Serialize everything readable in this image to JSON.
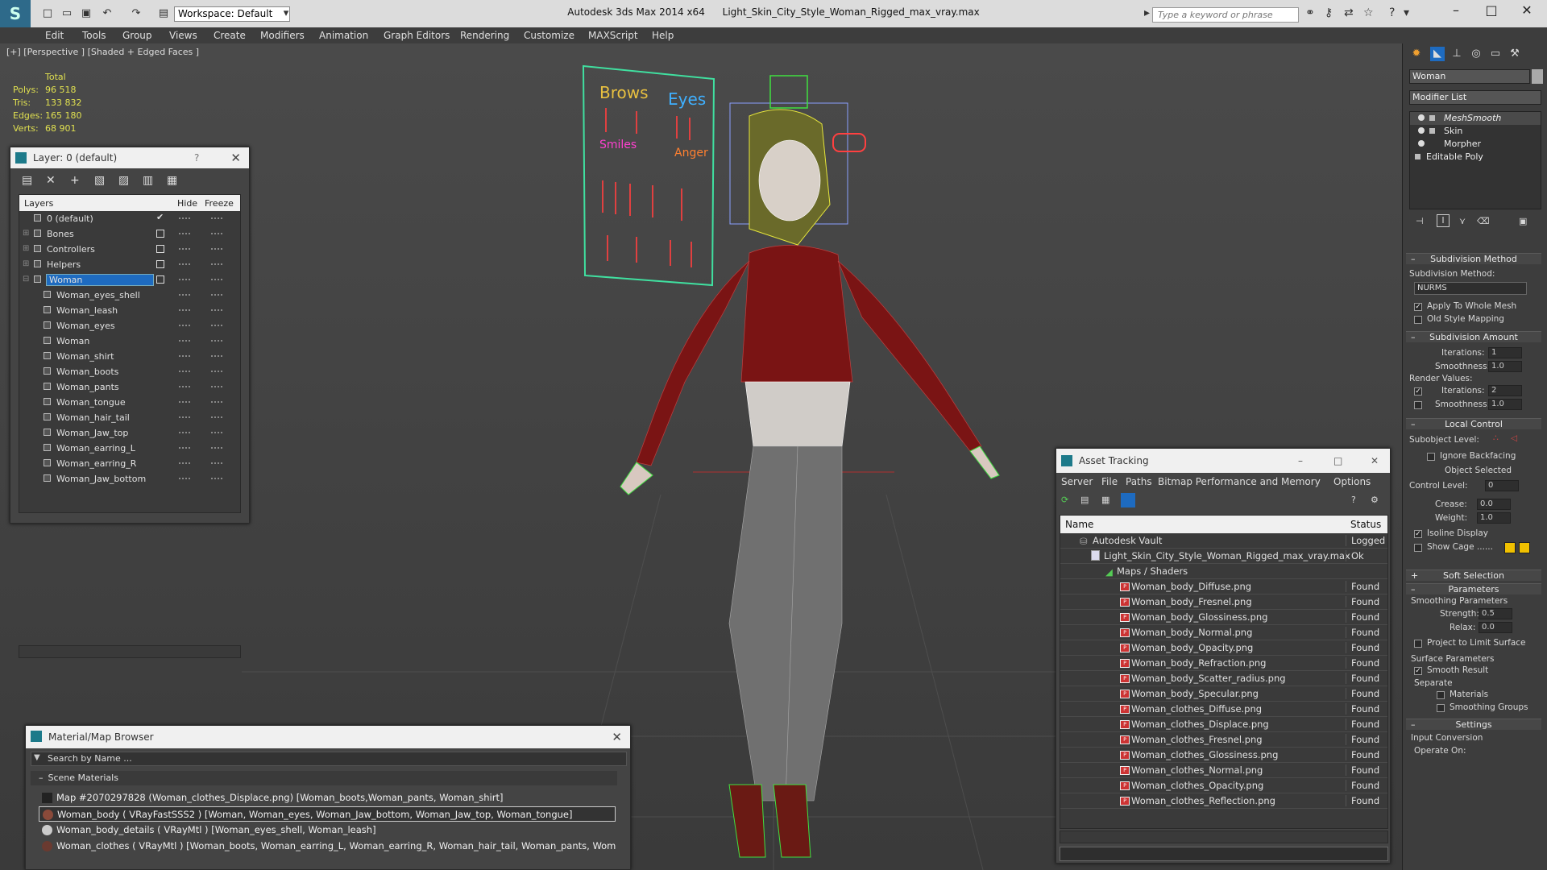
{
  "titlebar": {
    "app": "Autodesk 3ds Max  2014 x64",
    "file": "Light_Skin_City_Style_Woman_Rigged_max_vray.max",
    "workspace": "Workspace: Default",
    "search_placeholder": "Type a keyword or phrase"
  },
  "menu": [
    "Edit",
    "Tools",
    "Group",
    "Views",
    "Create",
    "Modifiers",
    "Animation",
    "Graph Editors",
    "Rendering",
    "Customize",
    "MAXScript",
    "Help"
  ],
  "viewport": {
    "label": "[+] [Perspective ] [Shaded + Edged Faces ]",
    "stats_total": "Total",
    "stats": [
      {
        "label": "Polys:",
        "value": "96 518"
      },
      {
        "label": "Tris:",
        "value": "133 832"
      },
      {
        "label": "Edges:",
        "value": "165 180"
      },
      {
        "label": "Verts:",
        "value": "68 901"
      }
    ],
    "rig_board": {
      "brows": "Brows",
      "eyes": "Eyes",
      "smiles": "Smiles",
      "anger": "Anger"
    }
  },
  "layer_panel": {
    "title": "Layer: 0 (default)",
    "help": "?",
    "col_layers": "Layers",
    "col_hide": "Hide",
    "col_freeze": "Freeze",
    "layers": [
      "0 (default)",
      "Bones",
      "Controllers",
      "Helpers",
      "Woman"
    ],
    "objects": [
      "Woman_eyes_shell",
      "Woman_leash",
      "Woman_eyes",
      "Woman",
      "Woman_shirt",
      "Woman_boots",
      "Woman_pants",
      "Woman_tongue",
      "Woman_hair_tail",
      "Woman_Jaw_top",
      "Woman_earring_L",
      "Woman_earring_R",
      "Woman_Jaw_bottom"
    ]
  },
  "asset_panel": {
    "title": "Asset Tracking",
    "menu": [
      "Server",
      "File",
      "Paths",
      "Bitmap Performance and Memory",
      "Options"
    ],
    "col_name": "Name",
    "col_status": "Status",
    "vault": {
      "name": "Autodesk Vault",
      "status": "Logged O"
    },
    "file": {
      "name": "Light_Skin_City_Style_Woman_Rigged_max_vray.max",
      "status": "Ok"
    },
    "maps_label": "Maps / Shaders",
    "maps": [
      {
        "name": "Woman_body_Diffuse.png",
        "status": "Found"
      },
      {
        "name": "Woman_body_Fresnel.png",
        "status": "Found"
      },
      {
        "name": "Woman_body_Glossiness.png",
        "status": "Found"
      },
      {
        "name": "Woman_body_Normal.png",
        "status": "Found"
      },
      {
        "name": "Woman_body_Opacity.png",
        "status": "Found"
      },
      {
        "name": "Woman_body_Refraction.png",
        "status": "Found"
      },
      {
        "name": "Woman_body_Scatter_radius.png",
        "status": "Found"
      },
      {
        "name": "Woman_body_Specular.png",
        "status": "Found"
      },
      {
        "name": "Woman_clothes_Diffuse.png",
        "status": "Found"
      },
      {
        "name": "Woman_clothes_Displace.png",
        "status": "Found"
      },
      {
        "name": "Woman_clothes_Fresnel.png",
        "status": "Found"
      },
      {
        "name": "Woman_clothes_Glossiness.png",
        "status": "Found"
      },
      {
        "name": "Woman_clothes_Normal.png",
        "status": "Found"
      },
      {
        "name": "Woman_clothes_Opacity.png",
        "status": "Found"
      },
      {
        "name": "Woman_clothes_Reflection.png",
        "status": "Found"
      }
    ]
  },
  "material_browser": {
    "title": "Material/Map Browser",
    "search_placeholder": "Search by Name ...",
    "section": "Scene Materials",
    "items": [
      "Map #2070297828 (Woman_clothes_Displace.png) [Woman_boots,Woman_pants, Woman_shirt]",
      "Woman_body  ( VRayFastSSS2 ) [Woman, Woman_eyes, Woman_Jaw_bottom, Woman_Jaw_top, Woman_tongue]",
      "Woman_body_details  ( VRayMtl ) [Woman_eyes_shell, Woman_leash]",
      "Woman_clothes  ( VRayMtl ) [Woman_boots, Woman_earring_L, Woman_earring_R, Woman_hair_tail, Woman_pants, Woman_shirt]"
    ]
  },
  "command_panel": {
    "object_name": "Woman",
    "modifier_list": "Modifier List",
    "stack": [
      "MeshSmooth",
      "Skin",
      "Morpher",
      "Editable Poly"
    ],
    "subdivision_method_title": "Subdivision Method",
    "subdivision_method_label": "Subdivision Method:",
    "subdivision_method_value": "NURMS",
    "apply_whole_mesh": "Apply To Whole Mesh",
    "old_style_mapping": "Old Style Mapping",
    "subdivision_amount_title": "Subdivision Amount",
    "iterations_label": "Iterations:",
    "iterations_value": "1",
    "smoothness_label": "Smoothness:",
    "smoothness_value": "1.0",
    "render_values": "Render Values:",
    "render_iterations_value": "2",
    "render_smoothness_value": "1.0",
    "local_control_title": "Local Control",
    "subobject_level": "Subobject Level:",
    "ignore_backfacing": "Ignore Backfacing",
    "object_selected": "Object Selected",
    "control_level": "Control Level:",
    "control_level_value": "0",
    "crease": "Crease:",
    "crease_value": "0.0",
    "weight": "Weight:",
    "weight_value": "1.0",
    "isoline_display": "Isoline Display",
    "show_cage": "Show Cage ......",
    "soft_selection_title": "Soft Selection",
    "parameters_title": "Parameters",
    "smoothing_parameters": "Smoothing Parameters",
    "strength": "Strength:",
    "strength_value": "0.5",
    "relax": "Relax:",
    "relax_value": "0.0",
    "project_limit": "Project to Limit Surface",
    "surface_parameters": "Surface Parameters",
    "smooth_result": "Smooth Result",
    "separate": "Separate",
    "materials": "Materials",
    "smoothing_groups": "Smoothing Groups",
    "settings_title": "Settings",
    "input_conversion": "Input Conversion",
    "operate_on": "Operate On:"
  },
  "colors": {
    "layer_selection": "#1e6bc0",
    "stats_yellow": "#e0e050",
    "wire_yellow": "#e6e63c",
    "shirt_red": "#7a1414",
    "cage_swatch": "#f0c000"
  }
}
